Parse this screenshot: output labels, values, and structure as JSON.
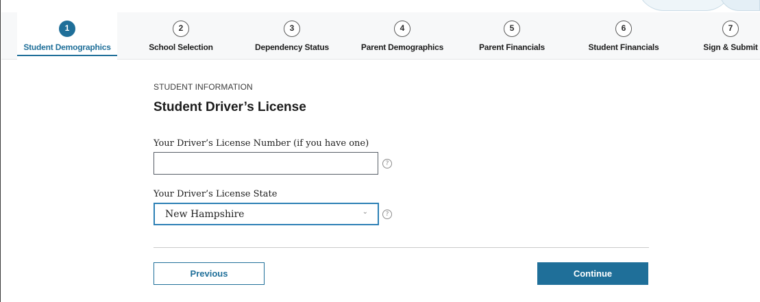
{
  "steps": [
    {
      "number": "1",
      "label": "Student Demographics",
      "active": true
    },
    {
      "number": "2",
      "label": "School Selection",
      "active": false
    },
    {
      "number": "3",
      "label": "Dependency Status",
      "active": false
    },
    {
      "number": "4",
      "label": "Parent Demographics",
      "active": false
    },
    {
      "number": "5",
      "label": "Parent Financials",
      "active": false
    },
    {
      "number": "6",
      "label": "Student Financials",
      "active": false
    },
    {
      "number": "7",
      "label": "Sign & Submit",
      "active": false
    }
  ],
  "section": {
    "eyebrow": "STUDENT INFORMATION",
    "title": "Student Driver’s License"
  },
  "form": {
    "license_number": {
      "label": "Your Driver’s License Number (if you have one)",
      "value": ""
    },
    "license_state": {
      "label": "Your Driver’s License State",
      "value": "New Hampshire"
    },
    "help_glyph": "?"
  },
  "buttons": {
    "previous": "Previous",
    "continue": "Continue"
  },
  "colors": {
    "accent": "#1f6f99",
    "focus": "#2b7fb5"
  },
  "icons": {
    "help": "question-circle-icon",
    "select": "chevron-down-icon"
  }
}
